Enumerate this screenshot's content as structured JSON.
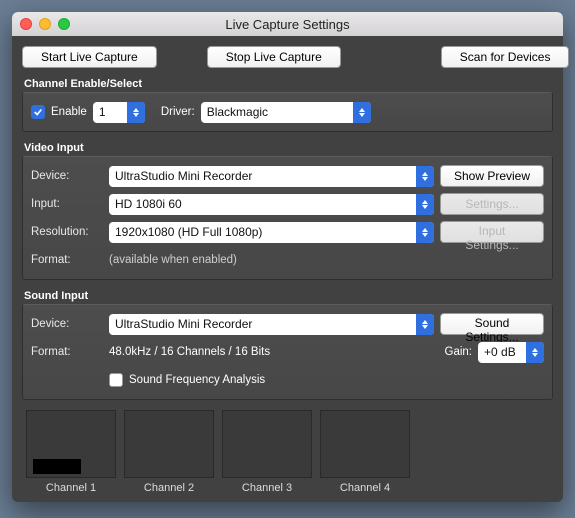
{
  "window": {
    "title": "Live Capture Settings"
  },
  "topbar": {
    "start": "Start Live Capture",
    "stop": "Stop Live Capture",
    "scan": "Scan for Devices"
  },
  "channel": {
    "heading": "Channel Enable/Select",
    "enable_label": "Enable",
    "enable_checked": true,
    "channel_num": "1",
    "driver_label": "Driver:",
    "driver": "Blackmagic"
  },
  "video": {
    "heading": "Video Input",
    "device_label": "Device:",
    "device": "UltraStudio Mini Recorder",
    "preview_btn": "Show Preview",
    "input_label": "Input:",
    "input": "HD 1080i 60",
    "settings_btn": "Settings...",
    "resolution_label": "Resolution:",
    "resolution": "1920x1080 (HD Full 1080p)",
    "input_settings_btn": "Input Settings...",
    "format_label": "Format:",
    "format_value": "(available when enabled)"
  },
  "sound": {
    "heading": "Sound Input",
    "device_label": "Device:",
    "device": "UltraStudio Mini Recorder",
    "sound_settings_btn": "Sound Settings...",
    "format_label": "Format:",
    "format_value": "48.0kHz / 16 Channels / 16 Bits",
    "gain_label": "Gain:",
    "gain": "+0 dB",
    "freq_checked": false,
    "freq_label": "Sound Frequency Analysis"
  },
  "channels": {
    "labels": [
      "Channel 1",
      "Channel 2",
      "Channel 3",
      "Channel 4"
    ]
  }
}
